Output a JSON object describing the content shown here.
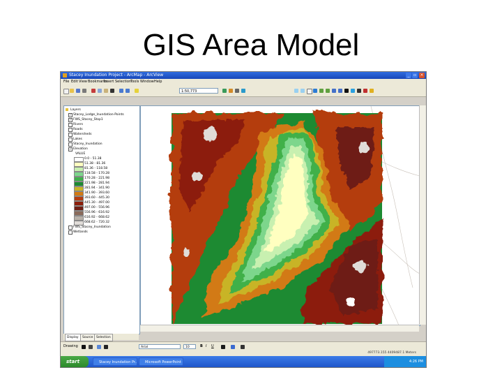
{
  "slide": {
    "title": "GIS Area Model"
  },
  "window": {
    "title": "Stacey Inundation Project - ArcMap - ArcView"
  },
  "menu": [
    "File",
    "Edit",
    "View",
    "Bookmarks",
    "Insert",
    "Selection",
    "Tools",
    "Window",
    "Help"
  ],
  "toolbar": {
    "scale": "1:50,773"
  },
  "toc": {
    "layers": [
      {
        "label": "Layers",
        "checked": false
      },
      {
        "label": "Stacey_Lodge_Inundation-Points",
        "checked": true
      },
      {
        "label": "FWS_Stacey_Stop1",
        "checked": true
      },
      {
        "label": "Rivers",
        "checked": false
      },
      {
        "label": "Roads",
        "checked": false
      },
      {
        "label": "Watersheds",
        "checked": false
      },
      {
        "label": "Lakes",
        "checked": false
      },
      {
        "label": "Stacey_Inundation",
        "checked": false
      },
      {
        "label": "Elevation",
        "checked": true
      },
      {
        "label": "VALUE",
        "checked": false
      }
    ],
    "legend": [
      {
        "label": "0.0 - 51.38",
        "color": "#ffffff"
      },
      {
        "label": "51.38 - 81.36",
        "color": "#ffffc0"
      },
      {
        "label": "81.36 - 118.58",
        "color": "#c8f0b0"
      },
      {
        "label": "118.58 - 170.28",
        "color": "#7dd68c"
      },
      {
        "label": "170.28 - 221.98",
        "color": "#3fb04a"
      },
      {
        "label": "221.98 - 281.94",
        "color": "#1d8a32"
      },
      {
        "label": "281.94 - 341.90",
        "color": "#c8b428"
      },
      {
        "label": "341.90 - 393.60",
        "color": "#d27a14"
      },
      {
        "label": "393.60 - 445.30",
        "color": "#b43c10"
      },
      {
        "label": "445.30 - 497.00",
        "color": "#8c1e0a"
      },
      {
        "label": "497.00 - 556.96",
        "color": "#6e1e14"
      },
      {
        "label": "556.96 - 616.92",
        "color": "#8a6a5a"
      },
      {
        "label": "616.92 - 668.62",
        "color": "#b8b0a8"
      },
      {
        "label": "668.62 - 720.32",
        "color": "#e0dcd8"
      }
    ],
    "more_layers": [
      {
        "label": "FWS_Stacey_Inundation",
        "checked": false
      },
      {
        "label": "Wetlands",
        "checked": false
      }
    ],
    "tabs": [
      "Display",
      "Source",
      "Selection"
    ]
  },
  "drawing_toolbar": {
    "label": "Drawing",
    "font": "Arial",
    "size": "10"
  },
  "status": {
    "coordinates": "497773.155  4409487.1 Meters"
  },
  "taskbar": {
    "start_label": "start",
    "tasks": [
      "Stacey Inundation Pr...",
      "Microsoft PowerPoint - ..."
    ],
    "clock": "4:26 PM"
  },
  "colors": {
    "titlebar": "#1c52c4",
    "taskbar": "#2a61d6",
    "start": "#3a9a3a"
  }
}
